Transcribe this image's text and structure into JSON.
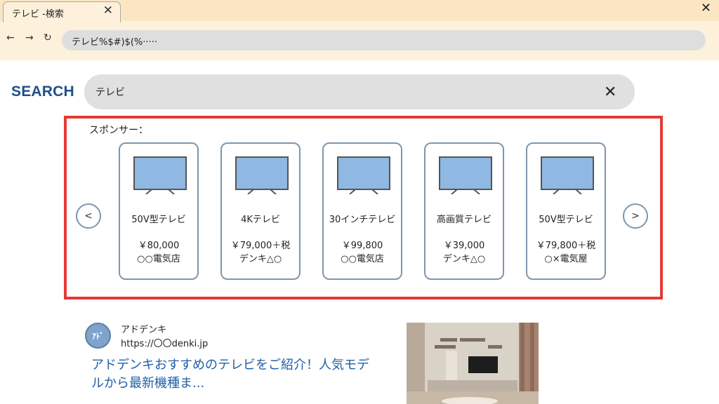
{
  "browser": {
    "tab_title": "テレビ -検索",
    "tab_close": "✕",
    "window_close": "✕",
    "nav_back": "←",
    "nav_forward": "→",
    "nav_reload": "↻",
    "url": "テレビ%$#)$(%·····"
  },
  "search": {
    "logo": "SEARCH",
    "query": "テレビ",
    "clear": "✕"
  },
  "sponsor": {
    "label": "スポンサー：",
    "prev": "<",
    "next": ">",
    "cards": [
      {
        "name": "50V型テレビ",
        "price": "￥80,000",
        "shop": "○○電気店"
      },
      {
        "name": "4Kテレビ",
        "price": "￥79,000＋税",
        "shop": "デンキ△○"
      },
      {
        "name": "30インチテレビ",
        "price": "￥99,800",
        "shop": "○○電気店"
      },
      {
        "name": "高画質テレビ",
        "price": "￥39,000",
        "shop": "デンキ△○"
      },
      {
        "name": "50V型テレビ",
        "price": "￥79,800＋税",
        "shop": "○×電気屋"
      }
    ]
  },
  "result": {
    "avatar_text": "ｱﾄﾞ",
    "site_name": "アドデンキ",
    "site_url": "https://〇〇denki.jp",
    "title": "アドデンキおすすめのテレビをご紹介！人気モデルから最新機種ま..."
  },
  "colors": {
    "accent_red": "#e53935",
    "logo_blue": "#1f4f8c",
    "link_blue": "#1f5fa8",
    "tv_screen": "#8fb8e3"
  }
}
